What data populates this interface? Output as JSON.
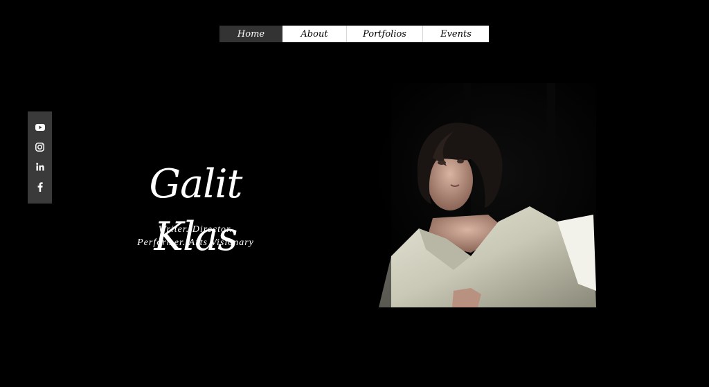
{
  "nav": {
    "items": [
      {
        "label": "Home",
        "active": true
      },
      {
        "label": "About",
        "active": false
      },
      {
        "label": "Portfolios",
        "active": false
      },
      {
        "label": "Events",
        "active": false
      }
    ]
  },
  "social": {
    "icons": [
      "youtube-icon",
      "instagram-icon",
      "linkedin-icon",
      "facebook-icon"
    ],
    "bar_color": "#3a3a3a"
  },
  "hero": {
    "name": "Galit Klas",
    "tagline_line1": "Writer. Director.",
    "tagline_line2": "Performer. Arts Visionary"
  },
  "colors": {
    "background": "#000000",
    "nav_active": "#333333",
    "nav_bg": "#ffffff"
  }
}
